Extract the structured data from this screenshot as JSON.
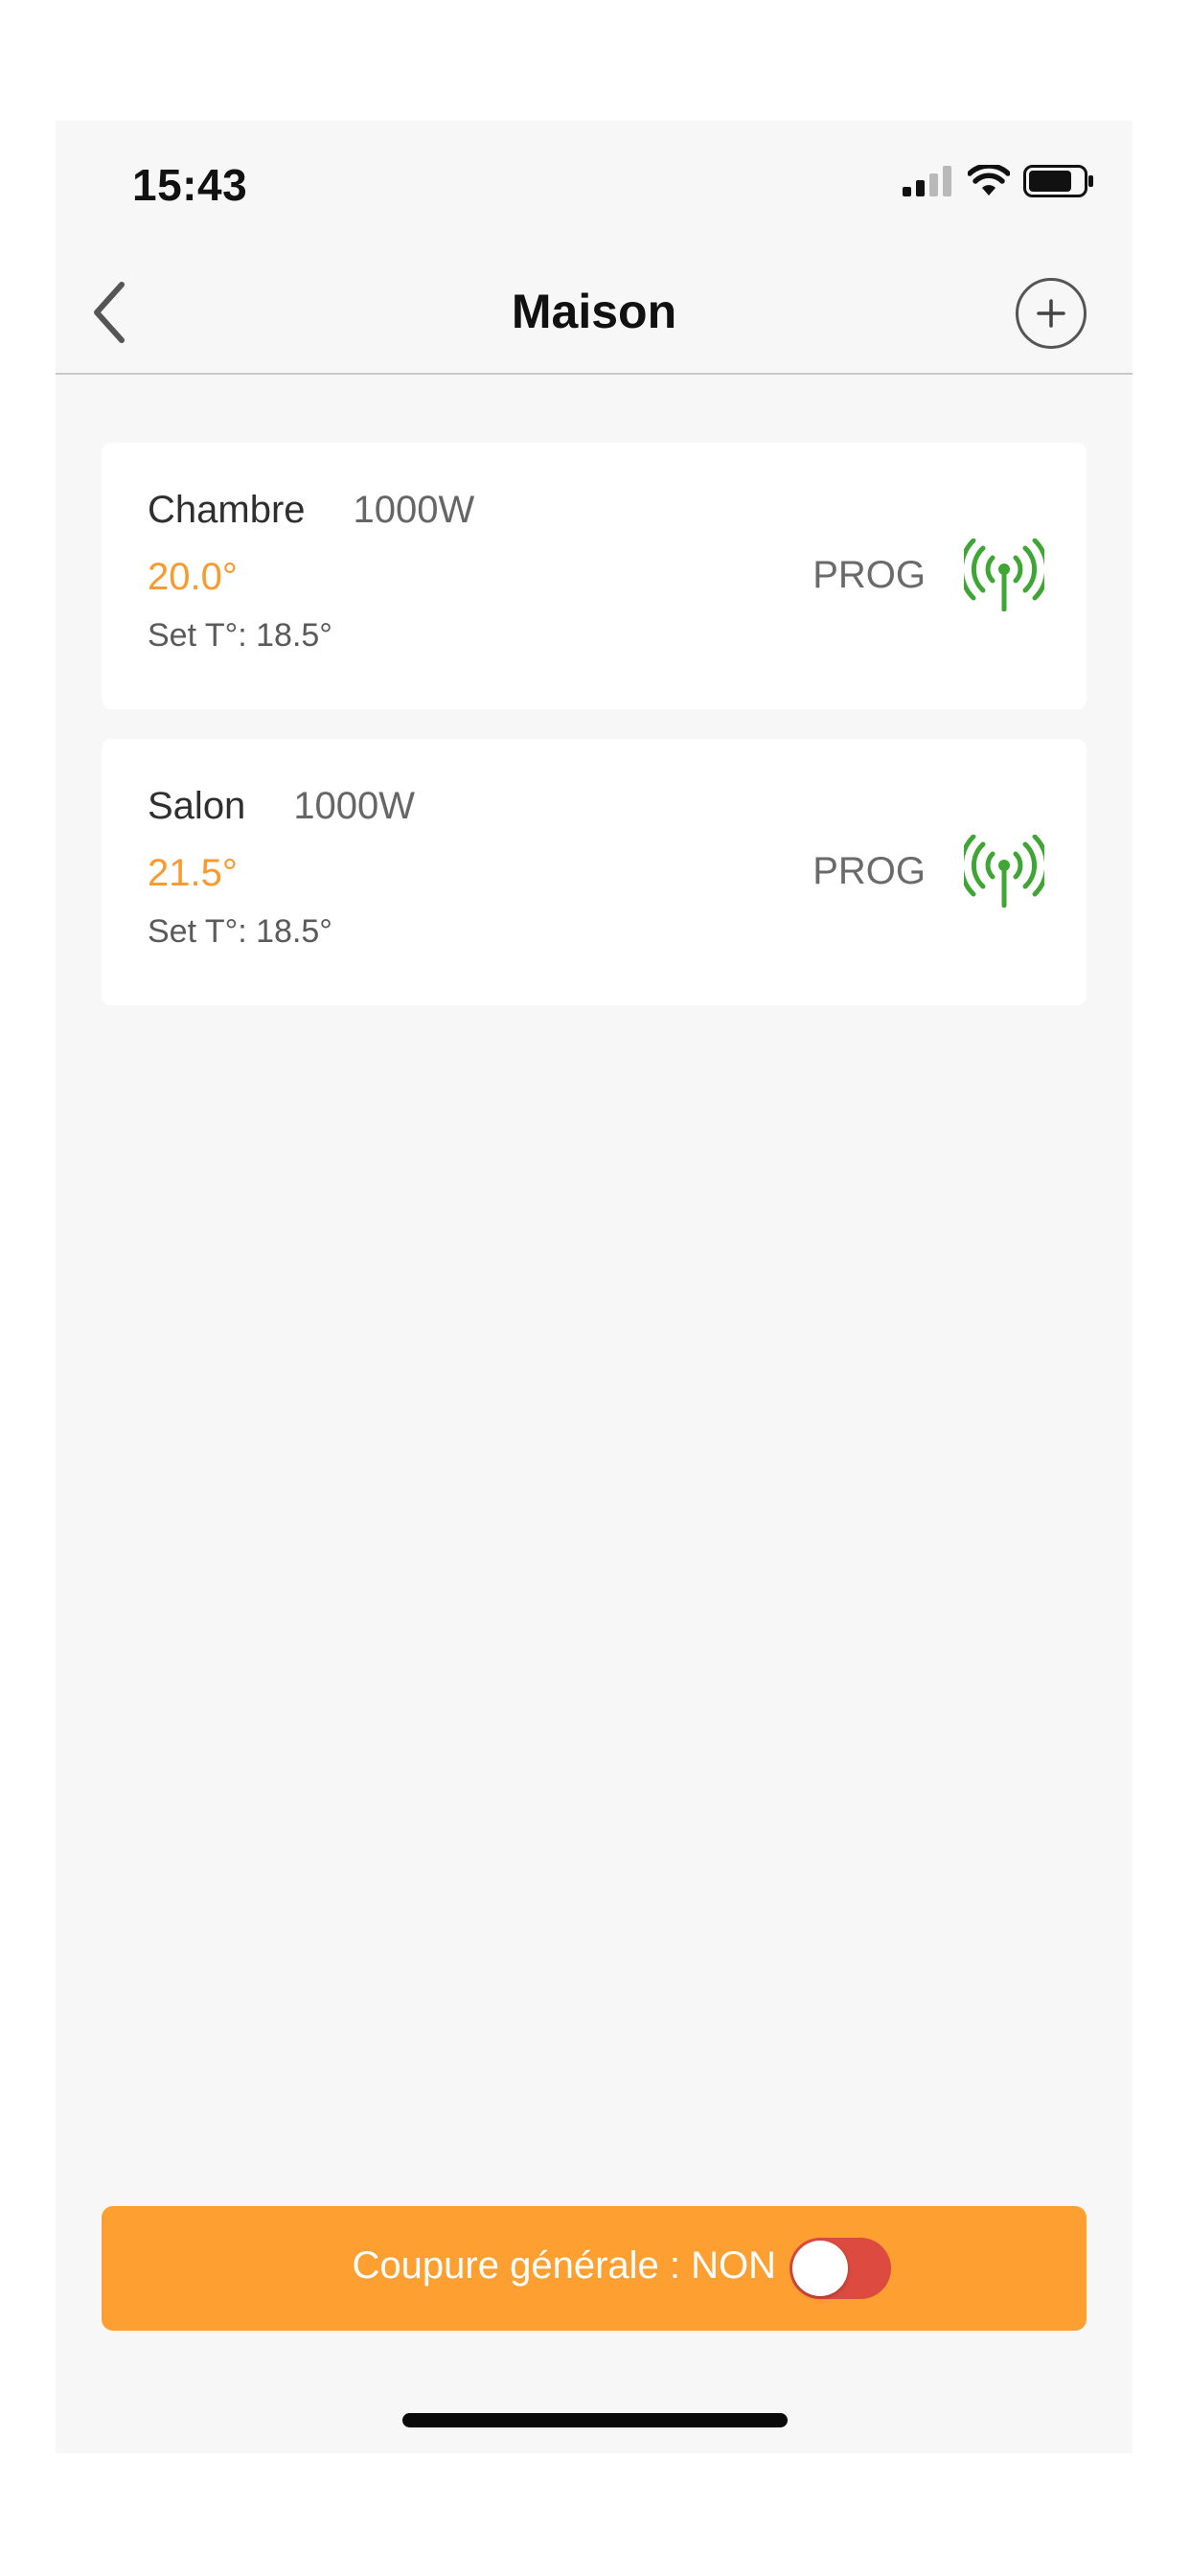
{
  "status_bar": {
    "time": "15:43"
  },
  "nav": {
    "title": "Maison"
  },
  "rooms": [
    {
      "name": "Chambre",
      "power": "1000W",
      "temperature": "20.0°",
      "set_temp": "Set T°: 18.5°",
      "mode": "PROG"
    },
    {
      "name": "Salon",
      "power": "1000W",
      "temperature": "21.5°",
      "set_temp": "Set T°: 18.5°",
      "mode": "PROG"
    }
  ],
  "master_switch": {
    "label": "Coupure générale : NON",
    "on": false
  },
  "colors": {
    "accent_orange": "#fd9f31",
    "temperature": "#f69b30",
    "signal_green": "#3fa535",
    "toggle_off": "#dd4a40"
  },
  "icons": {
    "back": "chevron-left-icon",
    "add": "plus-circle-icon",
    "signal": "antenna-signal-icon",
    "cellular": "cellular-signal-icon",
    "wifi": "wifi-icon",
    "battery": "battery-icon"
  }
}
